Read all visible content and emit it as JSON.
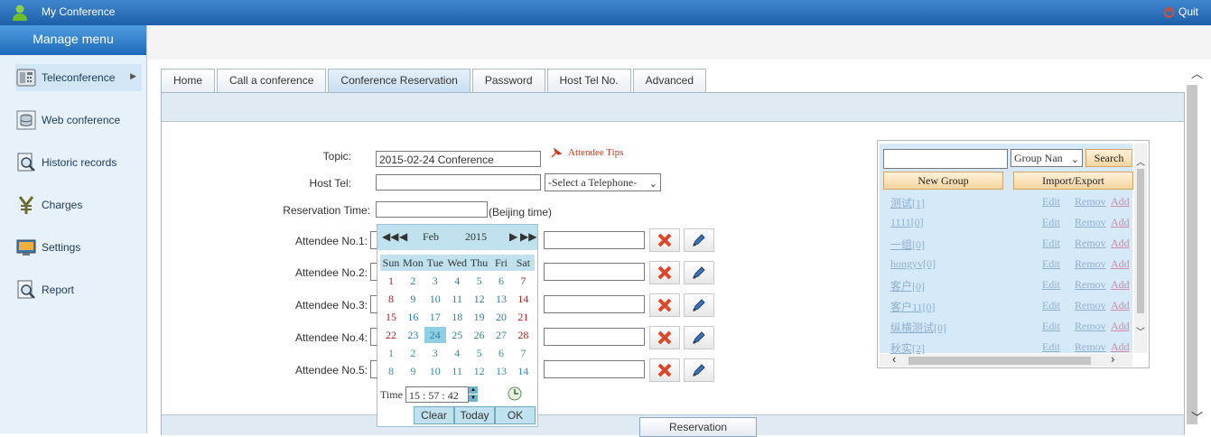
{
  "app": {
    "title": "My Conference",
    "quit_label": "Quit"
  },
  "sidebar": {
    "header": "Manage menu",
    "items": [
      {
        "label": "Teleconference",
        "icon": "phone-icon"
      },
      {
        "label": "Web conference",
        "icon": "database-icon"
      },
      {
        "label": "Historic records",
        "icon": "magnifier-icon"
      },
      {
        "label": "Charges",
        "icon": "yen-icon"
      },
      {
        "label": "Settings",
        "icon": "settings-monitor-icon"
      },
      {
        "label": "Report",
        "icon": "report-icon"
      }
    ]
  },
  "tabs": [
    {
      "label": "Home"
    },
    {
      "label": "Call a conference"
    },
    {
      "label": "Conference Reservation"
    },
    {
      "label": "Password"
    },
    {
      "label": "Host Tel No."
    },
    {
      "label": "Advanced"
    }
  ],
  "form": {
    "topic_label": "Topic:",
    "topic_value": "2015-02-24 Conference",
    "attendee_tips": "Attendee Tips",
    "host_tel_label": "Host Tel:",
    "host_tel_value": "",
    "telephone_select": "-Select a Telephone-",
    "reservation_time_label": "Reservation Time:",
    "reservation_time_value": "",
    "timezone_note": "(Beijing time)",
    "attendees": [
      {
        "label": "Attendee No.1:"
      },
      {
        "label": "Attendee No.2:"
      },
      {
        "label": "Attendee No.3:"
      },
      {
        "label": "Attendee No.4:"
      },
      {
        "label": "Attendee No.5:"
      }
    ],
    "reservation_button": "Reservation"
  },
  "calendar": {
    "month": "Feb",
    "year": "2015",
    "nav": {
      "prev_year": "◀◀",
      "prev_month": "◀",
      "next_month": "▶",
      "next_year": "▶▶"
    },
    "weekdays": [
      "Sun",
      "Mon",
      "Tue",
      "Wed",
      "Thu",
      "Fri",
      "Sat"
    ],
    "weeks": [
      [
        "1",
        "2",
        "3",
        "4",
        "5",
        "6",
        "7"
      ],
      [
        "8",
        "9",
        "10",
        "11",
        "12",
        "13",
        "14"
      ],
      [
        "15",
        "16",
        "17",
        "18",
        "19",
        "20",
        "21"
      ],
      [
        "22",
        "23",
        "24",
        "25",
        "26",
        "27",
        "28"
      ],
      [
        "1",
        "2",
        "3",
        "4",
        "5",
        "6",
        "7"
      ],
      [
        "8",
        "9",
        "10",
        "11",
        "12",
        "13",
        "14"
      ]
    ],
    "selected_day": "24",
    "time_label": "Time",
    "time_h": "15",
    "time_m": "57",
    "time_s": "42",
    "buttons": {
      "clear": "Clear",
      "today": "Today",
      "ok": "OK"
    },
    "colors": {
      "current_month_weekday": "#2e7fa3",
      "current_month_weekend": "#b32020",
      "other_month": "#2e8fb5",
      "selected_bg": "#8fcfe3"
    }
  },
  "groups": {
    "search_value": "",
    "filter_select": "Group Nan",
    "search_button": "Search",
    "new_group_button": "New Group",
    "import_export_button": "Import/Export",
    "list": [
      {
        "name": "测试[1]",
        "edit": "Edit",
        "remove": "Remov",
        "add": "Add"
      },
      {
        "name": "1111[0]",
        "edit": "Edit",
        "remove": "Remov",
        "add": "Add"
      },
      {
        "name": "一组[0]",
        "edit": "Edit",
        "remove": "Remov",
        "add": "Add"
      },
      {
        "name": "hongyv[0]",
        "edit": "Edit",
        "remove": "Remov",
        "add": "Add"
      },
      {
        "name": "客户[0]",
        "edit": "Edit",
        "remove": "Remov",
        "add": "Add"
      },
      {
        "name": "客户11[0]",
        "edit": "Edit",
        "remove": "Remov",
        "add": "Add"
      },
      {
        "name": "纵横测试[0]",
        "edit": "Edit",
        "remove": "Remov",
        "add": "Add"
      },
      {
        "name": "秋实[2]",
        "edit": "Edit",
        "remove": "Remov",
        "add": "Add"
      }
    ]
  }
}
